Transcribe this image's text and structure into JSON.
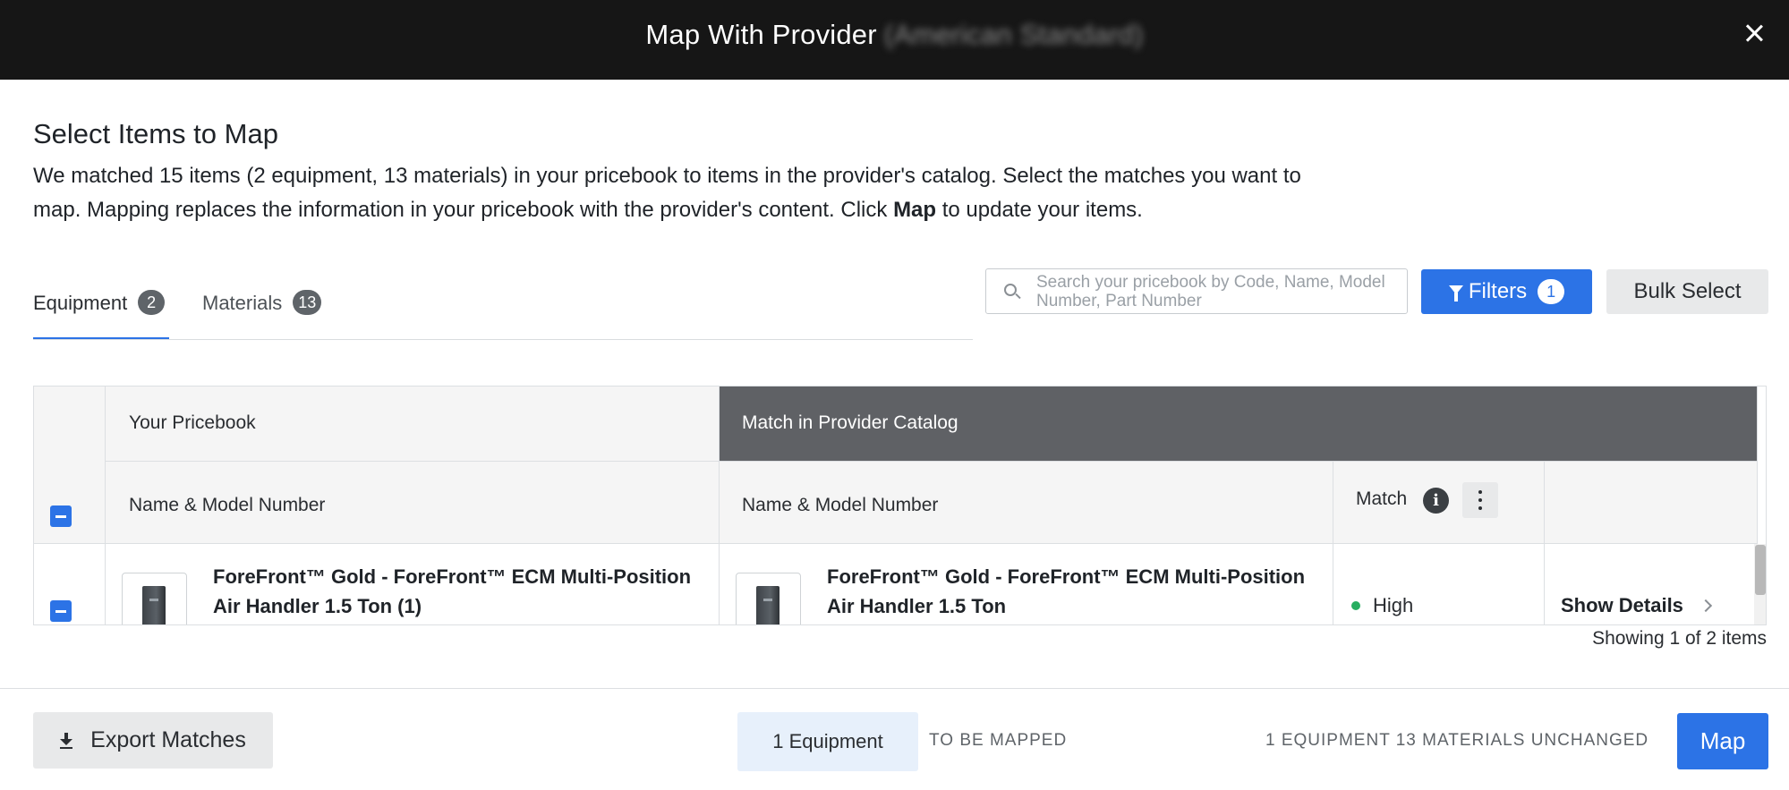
{
  "header": {
    "title": "Map With Provider",
    "provider_blurred": "(American Standard)"
  },
  "intro": {
    "heading": "Select Items to Map",
    "desc_part1": "We matched 15 items (2 equipment, 13 materials) in your pricebook to items in the provider's catalog. Select the matches you want to map. Mapping replaces the information in your pricebook with the provider's content. Click ",
    "desc_bold": "Map",
    "desc_part2": " to update your items."
  },
  "tabs": [
    {
      "label": "Equipment",
      "count": "2",
      "active": true
    },
    {
      "label": "Materials",
      "count": "13",
      "active": false
    }
  ],
  "search": {
    "placeholder": "Search your pricebook by Code, Name, Model Number, Part Number"
  },
  "actions": {
    "filters_label": "Filters",
    "filters_count": "1",
    "bulk_label": "Bulk Select"
  },
  "table": {
    "group_left": "Your Pricebook",
    "group_right": "Match in Provider Catalog",
    "col_pricebook_name": "Name & Model Number",
    "col_provider_name": "Name & Model Number",
    "col_match": "Match",
    "info_glyph": "i",
    "rows": [
      {
        "pricebook_name": "ForeFront™ Gold - ForeFront™ ECM Multi-Position Air Handler 1.5 Ton (1)",
        "provider_name": "ForeFront™ Gold - ForeFront™ ECM Multi-Position Air Handler 1.5 Ton",
        "match": "High",
        "match_color": "#27ae60",
        "details_label": "Show Details"
      }
    ]
  },
  "showing_text": "Showing 1 of 2 items",
  "footer": {
    "export_label": "Export Matches",
    "equipment_pill": "1 Equipment",
    "to_be_mapped": "TO BE MAPPED",
    "unchanged": "1 EQUIPMENT 13 MATERIALS UNCHANGED",
    "map_label": "Map"
  },
  "colors": {
    "primary": "#2c73e6",
    "header_bg": "#161616",
    "dark_group_bg": "#5f6165"
  }
}
